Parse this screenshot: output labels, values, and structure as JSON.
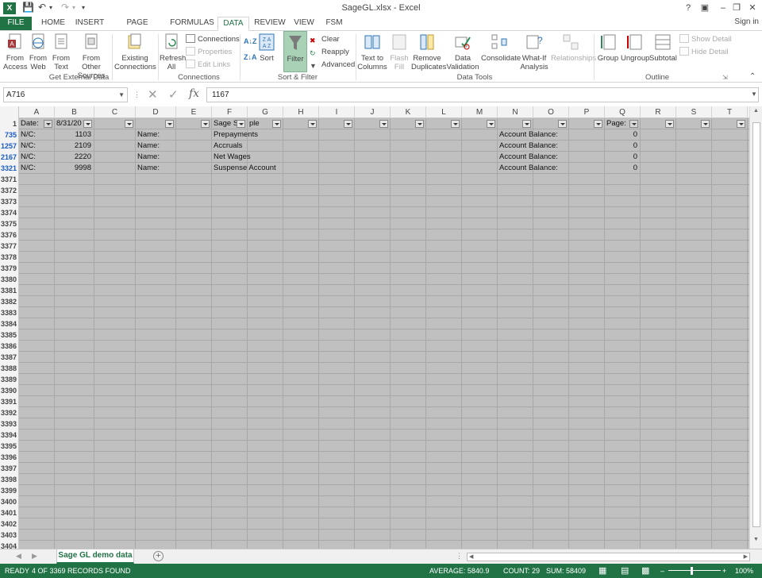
{
  "title_bar": {
    "app_logo": "X",
    "title": "SageGL.xlsx - Excel",
    "help": "?"
  },
  "tabs": [
    {
      "label": "FILE"
    },
    {
      "label": "HOME"
    },
    {
      "label": "INSERT"
    },
    {
      "label": "PAGE LAYOUT"
    },
    {
      "label": "FORMULAS"
    },
    {
      "label": "DATA"
    },
    {
      "label": "REVIEW"
    },
    {
      "label": "VIEW"
    },
    {
      "label": "FSM"
    }
  ],
  "sign_in": "Sign in",
  "ribbon": {
    "get_external": {
      "from_access": "From\nAccess",
      "from_web": "From\nWeb",
      "from_text": "From\nText",
      "from_other": "From Other\nSources",
      "existing": "Existing\nConnections",
      "group": "Get External Data"
    },
    "connections": {
      "refresh_all": "Refresh\nAll",
      "connections": "Connections",
      "properties": "Properties",
      "edit_links": "Edit Links",
      "group": "Connections"
    },
    "sort_filter": {
      "sort": "Sort",
      "filter": "Filter",
      "clear": "Clear",
      "reapply": "Reapply",
      "advanced": "Advanced",
      "group": "Sort & Filter"
    },
    "data_tools": {
      "text_to_columns": "Text to\nColumns",
      "flash_fill": "Flash\nFill",
      "remove_duplicates": "Remove\nDuplicates",
      "data_validation": "Data\nValidation",
      "consolidate": "Consolidate",
      "what_if": "What-If\nAnalysis",
      "relationships": "Relationships",
      "group": "Data Tools"
    },
    "outline": {
      "group_btn": "Group",
      "ungroup": "Ungroup",
      "subtotal": "Subtotal",
      "show_detail": "Show Detail",
      "hide_detail": "Hide Detail",
      "group": "Outline"
    }
  },
  "formula_bar": {
    "name_box": "A716",
    "formula": "1167"
  },
  "columns": [
    "A",
    "B",
    "C",
    "D",
    "E",
    "F",
    "G",
    "H",
    "I",
    "J",
    "K",
    "L",
    "M",
    "N",
    "O",
    "P",
    "Q",
    "R",
    "S",
    "T"
  ],
  "header_row": {
    "row": "1",
    "A": "Date:",
    "B": "8/31/20",
    "F": "Sage Sa",
    "G": "ple",
    "N": "",
    "Q": "Page:"
  },
  "data_rows": [
    {
      "row": "735",
      "A": "N/C:",
      "B": "1103",
      "D": "Name:",
      "F": "Prepayments",
      "N": "Account Balance:",
      "Q": "0"
    },
    {
      "row": "1257",
      "A": "N/C:",
      "B": "2109",
      "D": "Name:",
      "F": "Accruals",
      "N": "Account Balance:",
      "Q": "0"
    },
    {
      "row": "2167",
      "A": "N/C:",
      "B": "2220",
      "D": "Name:",
      "F": "Net Wages",
      "N": "Account Balance:",
      "Q": "0"
    },
    {
      "row": "3321",
      "A": "N/C:",
      "B": "9998",
      "D": "Name:",
      "F": "Suspense Account",
      "N": "Account Balance:",
      "Q": "0"
    }
  ],
  "empty_rows": [
    "3371",
    "3372",
    "3373",
    "3374",
    "3375",
    "3376",
    "3377",
    "3378",
    "3379",
    "3380",
    "3381",
    "3382",
    "3383",
    "3384",
    "3385",
    "3386",
    "3387",
    "3388",
    "3389",
    "3390",
    "3391",
    "3392",
    "3393",
    "3394",
    "3395",
    "3396",
    "3397",
    "3398",
    "3399",
    "3400",
    "3401",
    "3402",
    "3403",
    "3404"
  ],
  "sheet_tab": "Sage GL demo data",
  "status": {
    "ready": "READY",
    "records": "4 OF 3369 RECORDS FOUND",
    "average": "AVERAGE: 5840.9",
    "count": "COUNT: 29",
    "sum": "SUM: 58409",
    "zoom": "100%"
  },
  "colors": {
    "excel_green": "#217346",
    "grid_gray": "#c0c0c0",
    "filtered_row_blue": "#1a5bc4"
  }
}
